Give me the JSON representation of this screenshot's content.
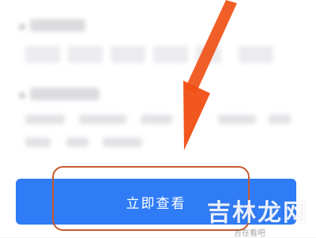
{
  "button": {
    "label": "立即查看"
  },
  "watermark": {
    "text": "吉林龙网",
    "sub": "吉在看吧"
  },
  "colors": {
    "accent": "#2f7cf6",
    "arrow": "#f04e12",
    "highlight": "#c75a2f"
  }
}
